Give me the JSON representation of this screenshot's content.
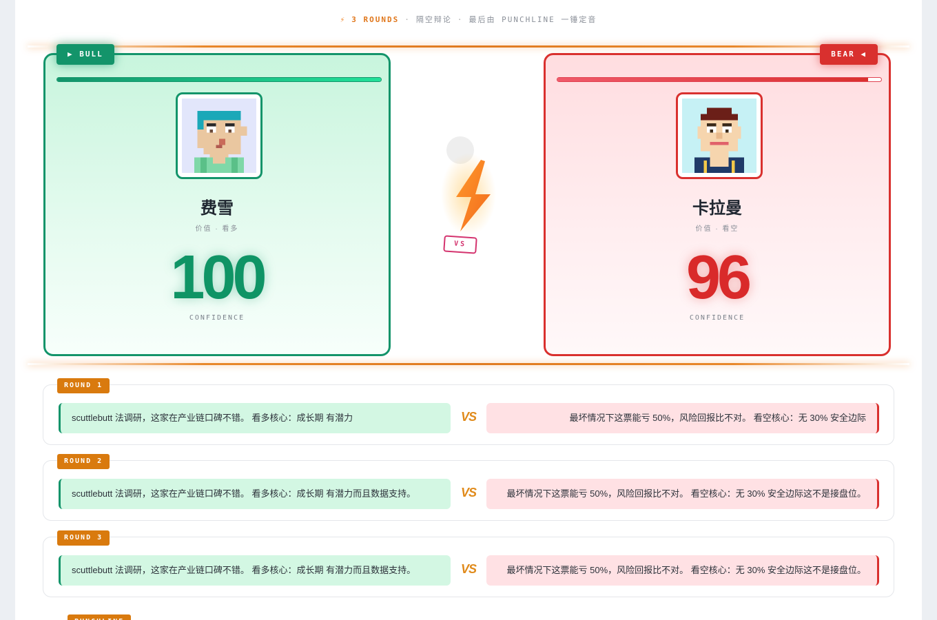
{
  "header": {
    "bolt": "⚡",
    "rounds": "3 ROUNDS",
    "sep": "·",
    "subtitle": "隔空辩论",
    "closing": "最后由 PUNCHLINE 一锤定音"
  },
  "bull": {
    "tag": "▶ BULL",
    "name": "费雪",
    "role": "价值 · 看多",
    "score": "100",
    "confidence_label": "CONFIDENCE",
    "progress_pct": 100,
    "avatar_icon": "pixel-avatar-teal-hair",
    "color": "#13946a"
  },
  "bear": {
    "tag": "BEAR ◀",
    "name": "卡拉曼",
    "role": "价值 · 看空",
    "score": "96",
    "confidence_label": "CONFIDENCE",
    "progress_pct": 96,
    "avatar_icon": "pixel-avatar-brown-hair",
    "color": "#d9302e"
  },
  "versus": {
    "icon": "lightning-bolt-icon",
    "label": "VS"
  },
  "rounds": [
    {
      "label": "ROUND 1",
      "vs": "VS",
      "bull_text": "scuttlebutt 法调研，这家在产业链口碑不错。 看多核心：成长期 有潜力",
      "bear_text": "最坏情况下这票能亏 50%，风险回报比不对。 看空核心：无 30% 安全边际"
    },
    {
      "label": "ROUND 2",
      "vs": "VS",
      "bull_text": "scuttlebutt 法调研，这家在产业链口碑不错。 看多核心：成长期 有潜力而且数据支持。",
      "bear_text": "最坏情况下这票能亏 50%，风险回报比不对。 看空核心：无 30% 安全边际这不是接盘位。"
    },
    {
      "label": "ROUND 3",
      "vs": "VS",
      "bull_text": "scuttlebutt 法调研，这家在产业链口碑不错。 看多核心：成长期 有潜力而且数据支持。",
      "bear_text": "最坏情况下这票能亏 50%，风险回报比不对。 看空核心：无 30% 安全边际这不是接盘位。"
    }
  ],
  "punchline": {
    "label": "PUNCHLINE"
  }
}
